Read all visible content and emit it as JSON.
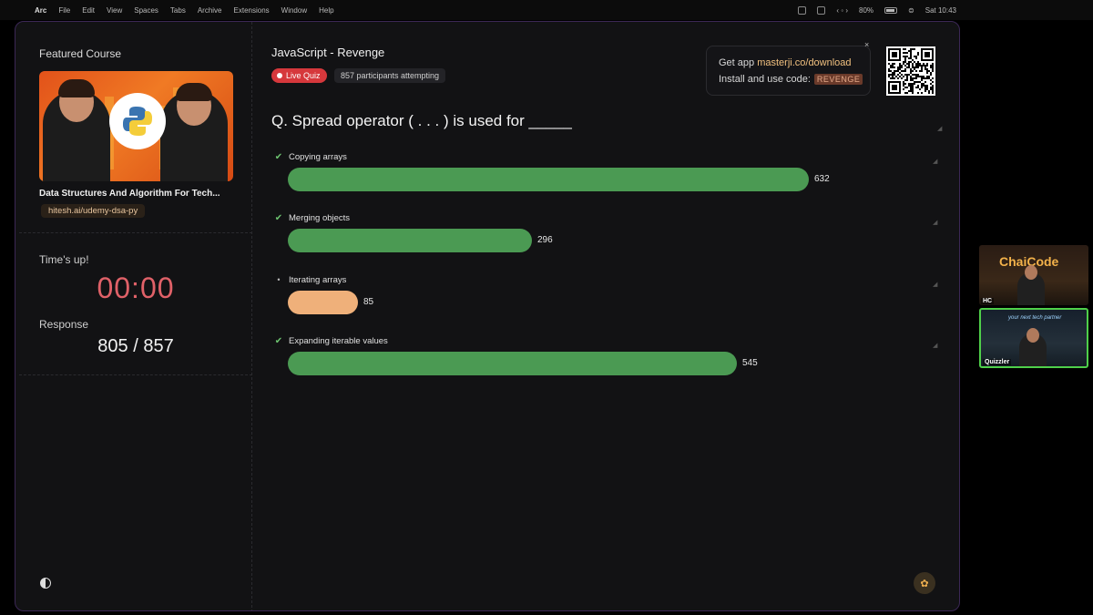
{
  "menubar": {
    "items": [
      "Arc",
      "File",
      "Edit",
      "View",
      "Spaces",
      "Tabs",
      "Archive",
      "Extensions",
      "Window",
      "Help"
    ],
    "battery": "80%",
    "clock": "Sat 10:43"
  },
  "sidebar": {
    "featured_title": "Featured Course",
    "course_name": "Data Structures And Algorithm For Tech...",
    "course_link": "hitesh.ai/udemy-dsa-py",
    "times_up": "Time's up!",
    "timer": "00:00",
    "response_label": "Response",
    "response_value": "805 / 857"
  },
  "quiz": {
    "title": "JavaScript - Revenge",
    "live_label": "Live Quiz",
    "participants": "857 participants attempting",
    "question": "Q. Spread operator ( . . . ) is used for _____",
    "options": [
      {
        "label": "Copying arrays",
        "count": "632",
        "value": 632,
        "correct": true
      },
      {
        "label": "Merging objects",
        "count": "296",
        "value": 296,
        "correct": true
      },
      {
        "label": "Iterating arrays",
        "count": "85",
        "value": 85,
        "correct": false
      },
      {
        "label": "Expanding iterable values",
        "count": "545",
        "value": 545,
        "correct": true
      }
    ],
    "max_value": 632
  },
  "promo": {
    "line1_prefix": "Get app ",
    "line1_link": "masterji.co/download",
    "line2_prefix": "Install and use code:",
    "code": "REVENGE",
    "close": "×"
  },
  "video_tiles": [
    {
      "name": "HC",
      "brand": "ChaiCode"
    },
    {
      "name": "Quizzler",
      "caption": "your next tech partner"
    }
  ],
  "icons": {
    "correct": "✔",
    "incorrect": "•"
  },
  "colors": {
    "correct_bar": "#4b9a53",
    "wrong_bar": "#efb07a",
    "timer": "#e06168",
    "live_badge": "#d6383c",
    "window_border": "#3b2755",
    "active_speaker": "#4fd04a"
  }
}
